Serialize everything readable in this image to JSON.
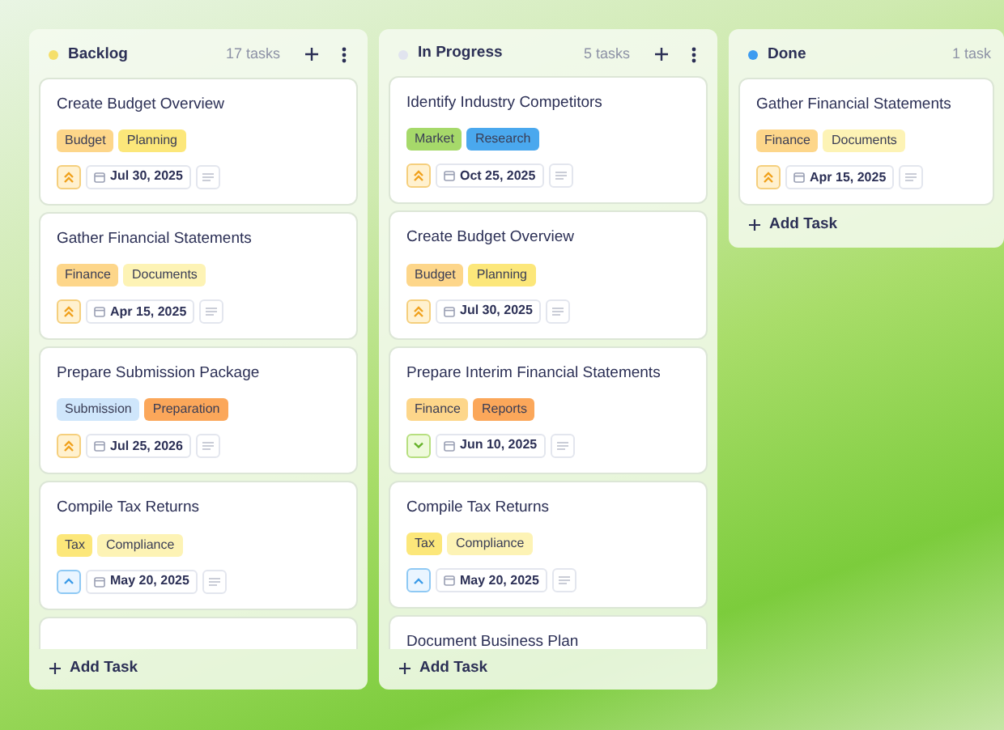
{
  "columns": [
    {
      "title": "Backlog",
      "color": "#f5df6a",
      "count": "17 tasks",
      "has_actions": true,
      "more_below": true,
      "cards": [
        {
          "title": "Create Budget Overview",
          "tags": [
            {
              "label": "Budget",
              "color": "#fdd68a"
            },
            {
              "label": "Planning",
              "color": "#fce77a"
            }
          ],
          "priority": {
            "kind": "high"
          },
          "date": "Jul 30, 2025"
        },
        {
          "title": "Gather Financial Statements",
          "tags": [
            {
              "label": "Finance",
              "color": "#fdd68a"
            },
            {
              "label": "Documents",
              "color": "#fdf3b5"
            }
          ],
          "priority": {
            "kind": "high"
          },
          "date": "Apr 15, 2025"
        },
        {
          "title": "Prepare Submission Package",
          "tags": [
            {
              "label": "Submission",
              "color": "#cfe6fb"
            },
            {
              "label": "Preparation",
              "color": "#fba75a"
            }
          ],
          "priority": {
            "kind": "high"
          },
          "date": "Jul 25, 2026"
        },
        {
          "title": "Compile Tax Returns",
          "tags": [
            {
              "label": "Tax",
              "color": "#fce77a"
            },
            {
              "label": "Compliance",
              "color": "#fdf3b5"
            }
          ],
          "priority": {
            "kind": "medium"
          },
          "date": "May 20, 2025"
        }
      ],
      "add_label": "Add Task"
    },
    {
      "title": "In Progress",
      "color": "#e1e4ef",
      "count": "5 tasks",
      "has_actions": true,
      "more_below": false,
      "cards": [
        {
          "title": "Identify Industry Competitors",
          "tags": [
            {
              "label": "Market",
              "color": "#a6d96a"
            },
            {
              "label": "Research",
              "color": "#4aa8ee"
            }
          ],
          "priority": {
            "kind": "high"
          },
          "date": "Oct 25, 2025"
        },
        {
          "title": "Create Budget Overview",
          "tags": [
            {
              "label": "Budget",
              "color": "#fdd68a"
            },
            {
              "label": "Planning",
              "color": "#fce77a"
            }
          ],
          "priority": {
            "kind": "high"
          },
          "date": "Jul 30, 2025"
        },
        {
          "title": "Prepare Interim Financial Statements",
          "tags": [
            {
              "label": "Finance",
              "color": "#fdd68a"
            },
            {
              "label": "Reports",
              "color": "#fba75a"
            }
          ],
          "priority": {
            "kind": "low"
          },
          "date": "Jun 10, 2025"
        },
        {
          "title": "Compile Tax Returns",
          "tags": [
            {
              "label": "Tax",
              "color": "#fce77a"
            },
            {
              "label": "Compliance",
              "color": "#fdf3b5"
            }
          ],
          "priority": {
            "kind": "medium"
          },
          "date": "May 20, 2025"
        },
        {
          "title": "Document Business Plan"
        }
      ],
      "add_label": "Add Task"
    },
    {
      "title": "Done",
      "color": "#3d9cf0",
      "count": "1 task",
      "has_actions": false,
      "more_below": false,
      "cards": [
        {
          "title": "Gather Financial Statements",
          "tags": [
            {
              "label": "Finance",
              "color": "#fdd68a"
            },
            {
              "label": "Documents",
              "color": "#fdf3b5"
            }
          ],
          "priority": {
            "kind": "high"
          },
          "date": "Apr 15, 2025"
        }
      ],
      "add_label": "Add Task"
    }
  ]
}
